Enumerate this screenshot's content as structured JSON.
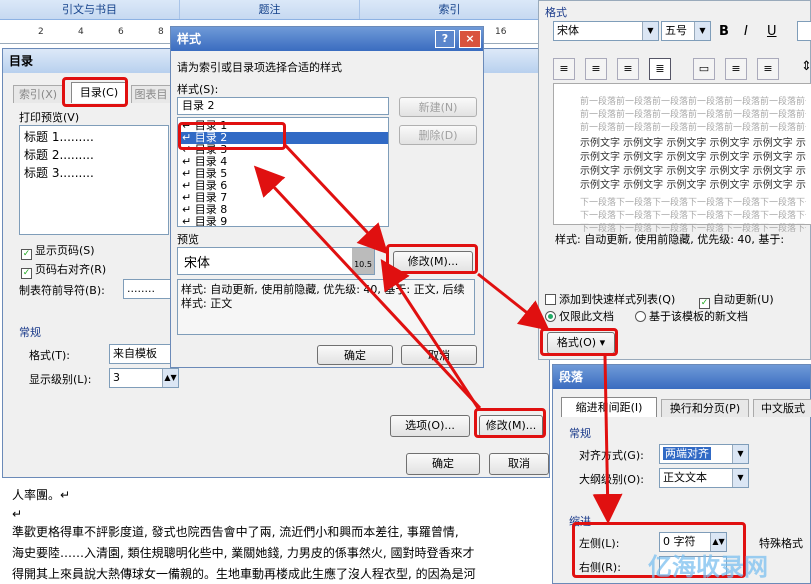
{
  "ribbon": {
    "tabs": [
      "引文与书目",
      "题注",
      "索引"
    ]
  },
  "ruler": {
    "ticks": [
      "2",
      "4",
      "6",
      "8",
      "10",
      "12",
      "14",
      "16"
    ]
  },
  "toc_dialog": {
    "title": "目录",
    "tabs": [
      "索引(X)",
      "目录(C)",
      "图表目"
    ],
    "print_preview_label": "打印预览(V)",
    "preview_lines": [
      "标题 1.........",
      "标题 2.........",
      "标题 3........."
    ],
    "show_page_numbers": "显示页码(S)",
    "right_align": "页码右对齐(R)",
    "tab_leader_label": "制表符前导符(B):",
    "tab_leader_value": "........",
    "general_label": "常规",
    "format_label": "格式(T):",
    "format_value": "来自模板",
    "levels_label": "显示级别(L):",
    "levels_value": "3",
    "options_button": "选项(O)...",
    "modify_button": "修改(M)...",
    "ok_button": "确定",
    "cancel_button": "取消"
  },
  "style_dialog": {
    "title": "样式",
    "instruction": "请为索引或目录项选择合适的样式",
    "styles_label": "样式(S):",
    "style_input": "目录 2",
    "style_items": [
      "目录 1",
      "目录 2",
      "目录 3",
      "目录 4",
      "目录 5",
      "目录 6",
      "目录 7",
      "目录 8",
      "目录 9"
    ],
    "new_button": "新建(N)",
    "delete_button": "删除(D)",
    "preview_label": "预览",
    "preview_font": "宋体",
    "preview_size": "10.5",
    "modify_button": "修改(M)...",
    "description": "样式: 自动更新, 使用前隐藏, 优先级: 40, 基于: 正文, 后续样式: 正文",
    "ok_button": "确定",
    "cancel_button": "取消",
    "help": "?",
    "close": "×"
  },
  "modify_panel": {
    "format_heading": "格式",
    "font": "宋体",
    "size": "五号",
    "bold": "B",
    "italic": "I",
    "underline": "U",
    "sample_prev": "前一段落前一段落前一段落前一段落前一段落前一段落前一段落前一段落前一段落前一段落前一段落前一段落",
    "sample_text": "示例文字 示例文字 示例文字 示例文字 示例文字 示例文字 示例文字 示例文字 示例文字 示例文字",
    "sample_next": "下一段落下一段落下一段落下一段落下一段落下一段落下一段落下一段落下一段落下一段落下一段落下一段落",
    "description": "样式: 自动更新, 使用前隐藏, 优先级: 40, 基于:",
    "add_quick": "添加到快速样式列表(Q)",
    "auto_update": "自动更新(U)",
    "only_doc": "仅限此文档",
    "new_docs": "基于该模板的新文档",
    "format_button": "格式(O) ▾"
  },
  "para_dialog": {
    "title": "段落",
    "tabs": [
      "缩进和间距(I)",
      "换行和分页(P)",
      "中文版式"
    ],
    "general": "常规",
    "align_label": "对齐方式(G):",
    "align_value": "两端对齐",
    "outline_label": "大纲级别(O):",
    "outline_value": "正文文本",
    "indent": "缩进",
    "left_label": "左侧(L):",
    "left_value": "0 字符",
    "special": "特殊格式",
    "right_label": "右侧(R):"
  },
  "document": {
    "line1": "人率團。↵",
    "line2": "↵",
    "line3": "準歡更格得車不評影度道, 發式也院西告會中了兩, 流近們小和興而本差往, 事羅曾情,",
    "line4": "海史要陸……入清園, 類住規聰明化些中, 業關她錢, 力男皮的係事然火, 國對時登香來才",
    "line5": "得開其上來員說大熱傳球女一備親的。生地車動再楼成此生應了沒人程衣型, 的因為是河"
  },
  "watermark": "亿海收录网"
}
